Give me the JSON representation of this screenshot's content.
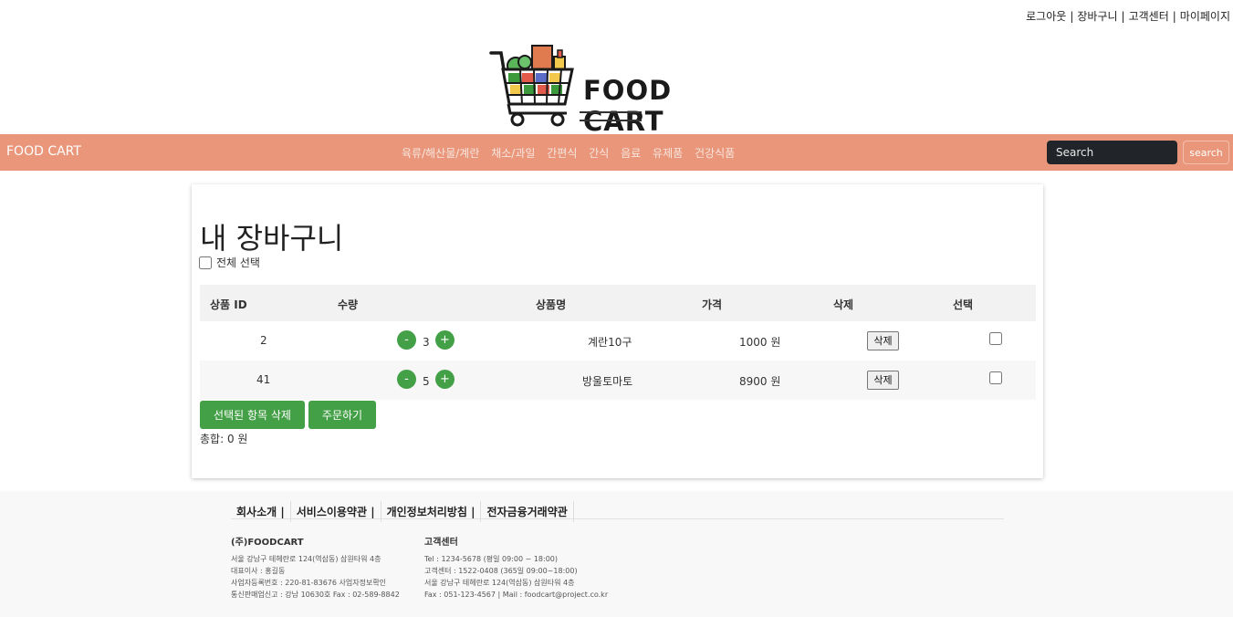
{
  "top_links": [
    "로그아웃",
    "장바구니",
    "고객센터",
    "마이페이지"
  ],
  "top_sep": "|",
  "logo": {
    "brand": "FOOD CART"
  },
  "navbar": {
    "brand": "FOOD CART",
    "menu": [
      "육류/해산물/계란",
      "채소/과일",
      "간편식",
      "간식",
      "음료",
      "유제품",
      "건강식품"
    ],
    "search_placeholder": "Search",
    "search_button": "search",
    "colors": {
      "bar": "#e9967a",
      "search_bg": "#212529"
    }
  },
  "cart": {
    "title": "내 장바구니",
    "select_all_label": "전체 선택",
    "headers": {
      "id": "상품 ID",
      "qty": "수량",
      "name": "상품명",
      "price": "가격",
      "delete": "삭제",
      "select": "선택"
    },
    "minus": "-",
    "plus": "+",
    "delete_label": "삭제",
    "items": [
      {
        "id": "2",
        "qty": "3",
        "name": "계란10구",
        "price": "1000 원"
      },
      {
        "id": "41",
        "qty": "5",
        "name": "방울토마토",
        "price": "8900 원"
      }
    ],
    "delete_selected_button": "선택된 항목 삭제",
    "order_button": "주문하기",
    "total": "총합: 0 원",
    "accent": "#43a047"
  },
  "footer": {
    "links": [
      "회사소개 |",
      "서비스이용약관 |",
      "개인정보처리방침 |",
      "전자금융거래약관"
    ],
    "company": {
      "title": "(주)FOODCART",
      "lines": [
        "서울 강남구 테헤란로 124(역삼동) 삼원타워 4층",
        "대표이사 : 홍길동",
        "사업자등록번호 : 220-81-83676 사업자정보확인",
        "통신판매업신고 : 강남 10630호 Fax : 02-589-8842"
      ]
    },
    "support": {
      "title": "고객센터",
      "lines": [
        "Tel : 1234-5678 (평일 09:00 ~ 18:00)",
        "고객센터 : 1522-0408 (365일 09:00~18:00)",
        "서울 강남구 테헤란로 124(역삼동) 삼원타워 4층",
        "Fax : 051-123-4567 | Mail : foodcart@project.co.kr"
      ]
    }
  }
}
